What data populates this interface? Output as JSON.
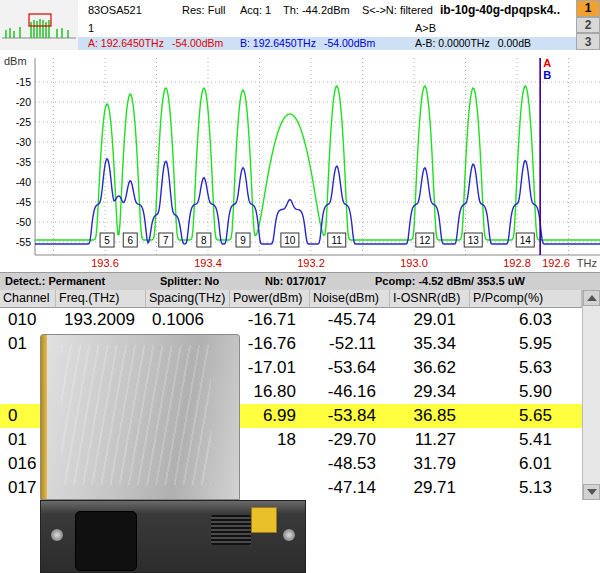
{
  "header": {
    "fields": [
      "83OSA521",
      "Res: Full",
      "Acq: 1",
      "Th: -44.2dBm",
      "S<->N: filtered"
    ],
    "title": "ib-10g-40g-dpqpsk4..",
    "trace": "1",
    "cursor_mode": "A>B",
    "readings": [
      {
        "label": "A: 192.6450THz",
        "value": "-54.00dBm",
        "color": "#e00000"
      },
      {
        "label": "B: 192.6450THz",
        "value": "-54.00dBm",
        "color": "#0000d0"
      },
      {
        "label": "A-B: 0.0000THz",
        "value": "0.00dB",
        "color": "#000000"
      }
    ]
  },
  "tabs": [
    {
      "label": "1",
      "selected": true
    },
    {
      "label": "2",
      "selected": false
    },
    {
      "label": "3",
      "selected": false
    }
  ],
  "chart": {
    "y_label": "dBm",
    "y_ticks": [
      "-15",
      "-20",
      "-25",
      "-30",
      "-35",
      "-40",
      "-45",
      "-50",
      "-55"
    ],
    "x_ticks": [
      "193.6",
      "193.4",
      "193.2",
      "193.0",
      "192.8",
      "192.6"
    ],
    "x_unit": "THz",
    "channels": [
      {
        "label": "5",
        "freq": 193.596,
        "width": 0.005
      },
      {
        "label": "6",
        "freq": 193.551,
        "width": 0.005
      },
      {
        "label": "7",
        "freq": 193.482,
        "width": 0.005
      },
      {
        "label": "8",
        "freq": 193.408,
        "width": 0.005
      },
      {
        "label": "9",
        "freq": 193.332,
        "width": 0.005
      },
      {
        "label": "10",
        "freq": 193.241,
        "width": 0.016
      },
      {
        "label": "11",
        "freq": 193.15,
        "width": 0.005
      },
      {
        "label": "12",
        "freq": 192.979,
        "width": 0.005
      },
      {
        "label": "13",
        "freq": 192.885,
        "width": 0.005
      },
      {
        "label": "14",
        "freq": 192.784,
        "width": 0.005
      }
    ],
    "series": [
      {
        "kind": "peaks",
        "color": "#1ee01e",
        "floor": -54.5,
        "values": [
          -20.5,
          -18,
          -16.5,
          -16.5,
          -17,
          -23,
          -16,
          -16,
          -16.5,
          -16
        ]
      },
      {
        "kind": "peaks-with-base",
        "color": "#2828c8",
        "floor": -55.5,
        "values": [
          -34.5,
          -41,
          -35,
          -40,
          -37,
          -48,
          -36.5,
          -37,
          -36,
          -35
        ],
        "base_values": [
          -46,
          -46,
          -49,
          -46,
          -46,
          -47.5,
          -46,
          -46,
          -46,
          -46
        ]
      }
    ],
    "cursors": [
      {
        "label": "A",
        "color": "#e00000",
        "freq": 192.755
      },
      {
        "label": "B",
        "color": "#0000d0",
        "freq": 192.755
      }
    ]
  },
  "status_bar": [
    "Detect.: Permanent",
    "Splitter: No",
    "Nb: 017/017",
    "Pcomp: -4.52 dBm/ 353.5 uW"
  ],
  "table": {
    "columns": [
      "Channel",
      "Freq.(THz)",
      "Spacing(THz)",
      "Power(dBm)",
      "Noise(dBm)",
      "I-OSNR(dB)",
      "P/Pcomp(%)"
    ],
    "rows": [
      {
        "cells": [
          "010",
          "193.2009",
          "0.1006",
          "-16.71",
          "-45.74",
          "29.01",
          "6.03"
        ],
        "selected": false
      },
      {
        "cells": [
          "01",
          "",
          "",
          "-16.76",
          "-52.11",
          "35.34",
          "5.95"
        ],
        "selected": false
      },
      {
        "cells": [
          "",
          "",
          "",
          "-17.01",
          "-53.64",
          "36.62",
          "5.63"
        ],
        "selected": false
      },
      {
        "cells": [
          "",
          "",
          "",
          "16.80",
          "-46.16",
          "29.34",
          "5.90"
        ],
        "selected": false
      },
      {
        "cells": [
          "0",
          "",
          "",
          "6.99",
          "-53.84",
          "36.85",
          "5.65"
        ],
        "selected": true
      },
      {
        "cells": [
          "01",
          "",
          "",
          "18",
          "-29.70",
          "11.27",
          "5.41"
        ],
        "selected": false
      },
      {
        "cells": [
          "016",
          "",
          "",
          "",
          "-48.53",
          "31.79",
          "6.01"
        ],
        "selected": false
      },
      {
        "cells": [
          "017",
          "",
          "",
          "",
          "-47.14",
          "29.71",
          "5.13"
        ],
        "selected": false
      }
    ]
  }
}
